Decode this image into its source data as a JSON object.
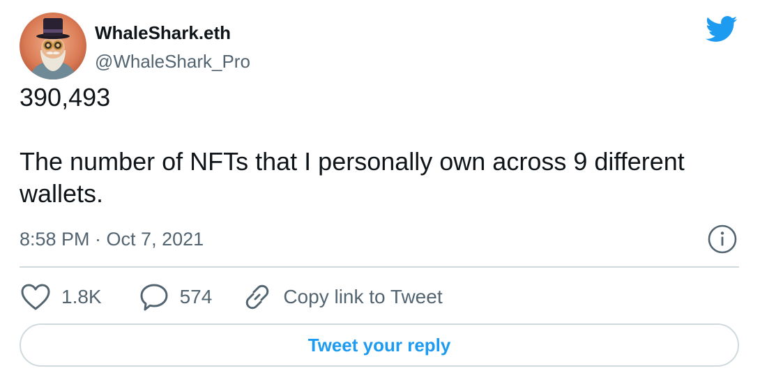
{
  "author": {
    "display_name": "WhaleShark.eth",
    "handle": "@WhaleShark_Pro",
    "avatar_icon": "top-hat-gentleman-avatar"
  },
  "brand": {
    "icon": "twitter-bird-icon",
    "color": "#1d9bf0"
  },
  "tweet": {
    "line1": "390,493",
    "line2": "The number of NFTs that I personally own across 9 different wallets."
  },
  "meta": {
    "timestamp": "8:58 PM · Oct 7, 2021",
    "info_icon": "info-icon"
  },
  "actions": {
    "like_count": "1.8K",
    "reply_count": "574",
    "copy_link_label": "Copy link to Tweet"
  },
  "reply_button": {
    "label": "Tweet your reply"
  },
  "colors": {
    "text_primary": "#0f1419",
    "text_secondary": "#536471",
    "divider": "#cfd9de",
    "accent": "#1d9bf0"
  }
}
